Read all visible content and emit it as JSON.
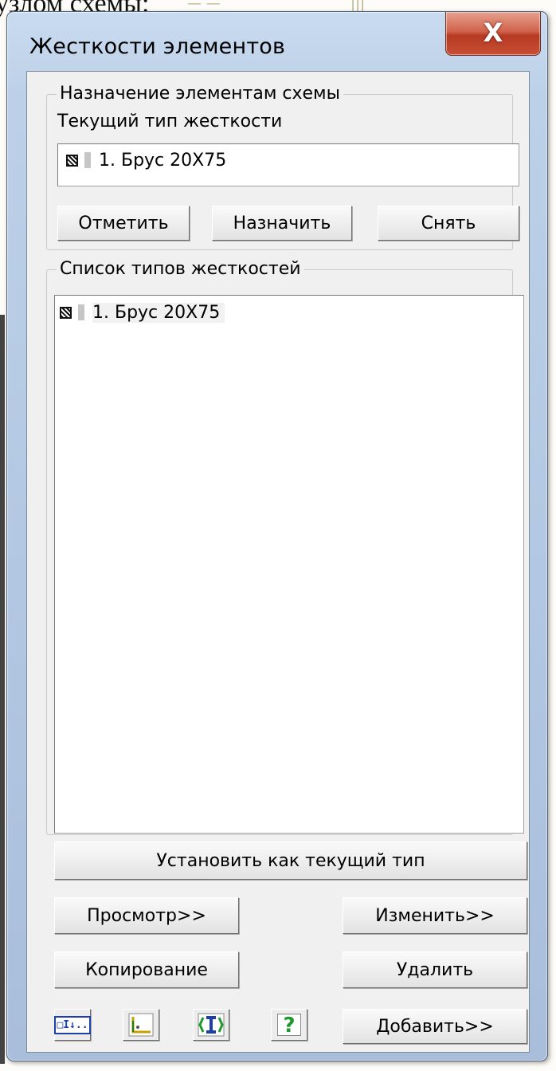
{
  "background": {
    "doc_text": "узлом схемы:"
  },
  "window": {
    "title": "Жесткости элементов",
    "close_glyph": "X"
  },
  "assign_group": {
    "title": "Назначение элементам схемы",
    "current_label": "Текущий тип жесткости",
    "current_value": "1. Брус 20X75",
    "buttons": {
      "mark": "Отметить",
      "assign": "Назначить",
      "remove": "Снять"
    }
  },
  "types_group": {
    "title": "Список типов жесткостей",
    "items": [
      {
        "label": "1. Брус 20X75"
      }
    ]
  },
  "buttons": {
    "set_current": "Установить как текущий тип",
    "view": "Просмотр>>",
    "edit": "Изменить>>",
    "copy": "Копирование",
    "delete": "Удалить",
    "add": "Добавить>>"
  },
  "toolbar": {
    "icons": [
      "import-stiffness-icon",
      "section-axes-icon",
      "section-profile-icon",
      "help-icon"
    ],
    "import_icon_text": "□I↓..",
    "help_glyph": "?"
  },
  "colors": {
    "dialog_face": "#f0f0f0",
    "title_bar": "#bcd0e8",
    "close_button": "#c74f34",
    "help_green": "#1e9a2c",
    "profile_blue": "#1c3fa8"
  }
}
